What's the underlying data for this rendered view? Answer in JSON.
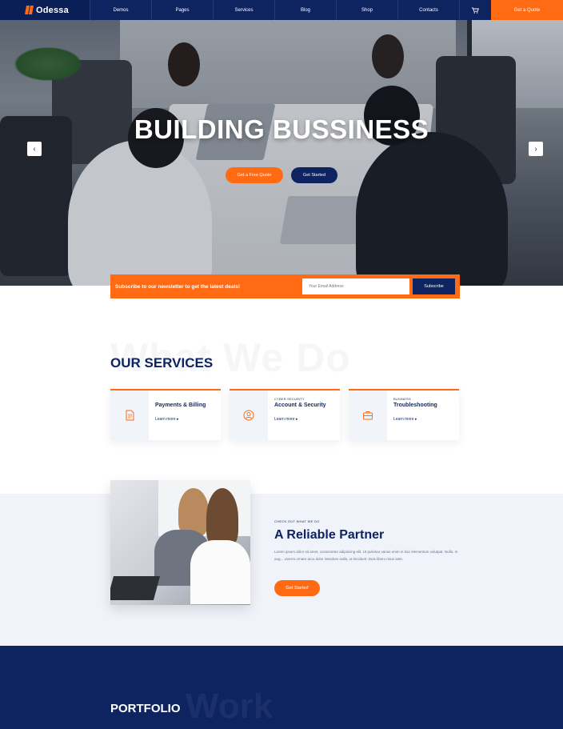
{
  "brand": {
    "name": "Odessa"
  },
  "nav": {
    "items": [
      "Demos",
      "Pages",
      "Services",
      "Blog",
      "Shop",
      "Contacts"
    ],
    "cart_icon": "cart-icon",
    "quote_label": "Get a Quote"
  },
  "hero": {
    "title": "BUILDING BUSSINESS",
    "primary_button": "Get a Free Quote",
    "secondary_button": "Get Started",
    "prev_icon": "chevron-left-icon",
    "next_icon": "chevron-right-icon"
  },
  "newsletter": {
    "text": "Subscribe to our newsletter to get the latest deals!",
    "placeholder": "Your Email Address",
    "button": "Subscribe"
  },
  "services": {
    "bg_word": "What We Do",
    "heading": "OUR SERVICES",
    "cards": [
      {
        "kicker": "",
        "title": "Payments & Billing",
        "link": "Learn more",
        "icon": "document-icon"
      },
      {
        "kicker": "CYBER SECURITY",
        "title": "Account & Security",
        "link": "Learn more",
        "icon": "user-icon"
      },
      {
        "kicker": "BUSINESS",
        "title": "Troubleshooting",
        "link": "Learn more",
        "icon": "briefcase-icon"
      }
    ]
  },
  "partner": {
    "kicker": "CHECK OUT WHAT WE DO",
    "title": "A Reliable Partner",
    "text": "Lorem ipsum dolor sit amet, consectetur adipiscing elit. Ut pulvinar varius enim in hac elementum volutpat. Nulla. In aug... viverra ornare arcu dolor interdum nulla, ut tincidunt. Duis libero risus ante.",
    "button": "Get Started"
  },
  "portfolio": {
    "bg_word": "Work",
    "heading": "PORTFOLIO"
  },
  "colors": {
    "navy": "#0d2461",
    "orange": "#ff6a13",
    "light_bg": "#f0f3f9"
  }
}
